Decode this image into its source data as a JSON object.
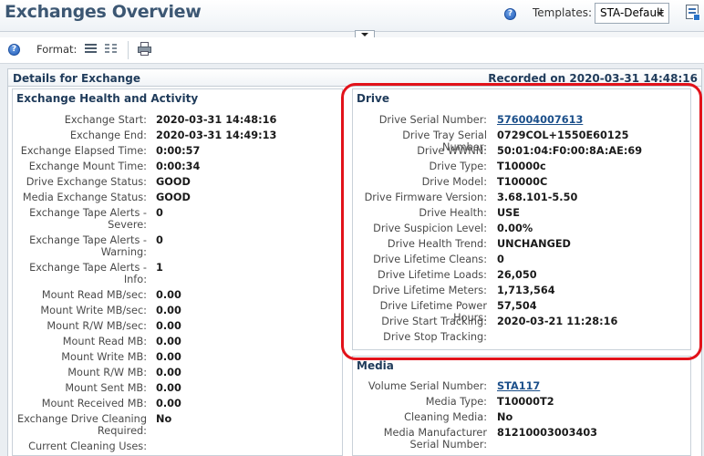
{
  "header": {
    "title": "Exchanges Overview",
    "templates_label": "Templates:",
    "template_value": "STA-Default"
  },
  "toolbar": {
    "format_label": "Format:"
  },
  "details": {
    "title": "Details for Exchange",
    "recorded": "Recorded on 2020-03-31 14:48:16"
  },
  "exchange_panel": {
    "title": "Exchange Health and Activity",
    "rows": [
      {
        "label": "Exchange Start:",
        "value": "2020-03-31 14:48:16"
      },
      {
        "label": "Exchange End:",
        "value": "2020-03-31 14:49:13"
      },
      {
        "label": "Exchange Elapsed Time:",
        "value": "0:00:57"
      },
      {
        "label": "Exchange Mount Time:",
        "value": "0:00:34"
      },
      {
        "label": "Drive Exchange Status:",
        "value": "GOOD"
      },
      {
        "label": "Media Exchange Status:",
        "value": "GOOD"
      },
      {
        "label": "Exchange Tape Alerts - Severe:",
        "value": "0"
      },
      {
        "label": "Exchange Tape Alerts - Warning:",
        "value": "0"
      },
      {
        "label": "Exchange Tape Alerts - Info:",
        "value": "1"
      },
      {
        "label": "Mount Read MB/sec:",
        "value": "0.00"
      },
      {
        "label": "Mount Write MB/sec:",
        "value": "0.00"
      },
      {
        "label": "Mount R/W MB/sec:",
        "value": "0.00"
      },
      {
        "label": "Mount Read MB:",
        "value": "0.00"
      },
      {
        "label": "Mount Write MB:",
        "value": "0.00"
      },
      {
        "label": "Mount R/W MB:",
        "value": "0.00"
      },
      {
        "label": "Mount Sent MB:",
        "value": "0.00"
      },
      {
        "label": "Mount Received MB:",
        "value": "0.00"
      },
      {
        "label": "Exchange Drive Cleaning Required:",
        "value": "No"
      },
      {
        "label": "Current Cleaning Uses:",
        "value": ""
      }
    ]
  },
  "drive_panel": {
    "title": "Drive",
    "rows": [
      {
        "label": "Drive Serial Number:",
        "value": "576004007613"
      },
      {
        "label": "Drive Tray Serial Number:",
        "value": "0729COL+1550E60125"
      },
      {
        "label": "Drive WWNN:",
        "value": "50:01:04:F0:00:8A:AE:69"
      },
      {
        "label": "Drive Type:",
        "value": "T10000c"
      },
      {
        "label": "Drive Model:",
        "value": "T10000C"
      },
      {
        "label": "Drive Firmware Version:",
        "value": "3.68.101-5.50"
      },
      {
        "label": "Drive Health:",
        "value": "USE"
      },
      {
        "label": "Drive Suspicion Level:",
        "value": "0.00%"
      },
      {
        "label": "Drive Health Trend:",
        "value": "UNCHANGED"
      },
      {
        "label": "Drive Lifetime Cleans:",
        "value": "0"
      },
      {
        "label": "Drive Lifetime Loads:",
        "value": "26,050"
      },
      {
        "label": "Drive Lifetime Meters:",
        "value": "1,713,564"
      },
      {
        "label": "Drive Lifetime Power Hours:",
        "value": "57,504"
      },
      {
        "label": "Drive Start Tracking:",
        "value": "2020-03-21 11:28:16"
      },
      {
        "label": "Drive Stop Tracking:",
        "value": ""
      }
    ]
  },
  "media_panel": {
    "title": "Media",
    "rows": [
      {
        "label": "Volume Serial Number:",
        "value": "STA117"
      },
      {
        "label": "Media Type:",
        "value": "T10000T2"
      },
      {
        "label": "Cleaning Media:",
        "value": "No"
      },
      {
        "label": "Media Manufacturer Serial Number:",
        "value": "81210003003403"
      }
    ]
  },
  "colors": {
    "highlight": "#e2121a",
    "title_blue": "#3c5773",
    "link": "#1b4f8a"
  }
}
